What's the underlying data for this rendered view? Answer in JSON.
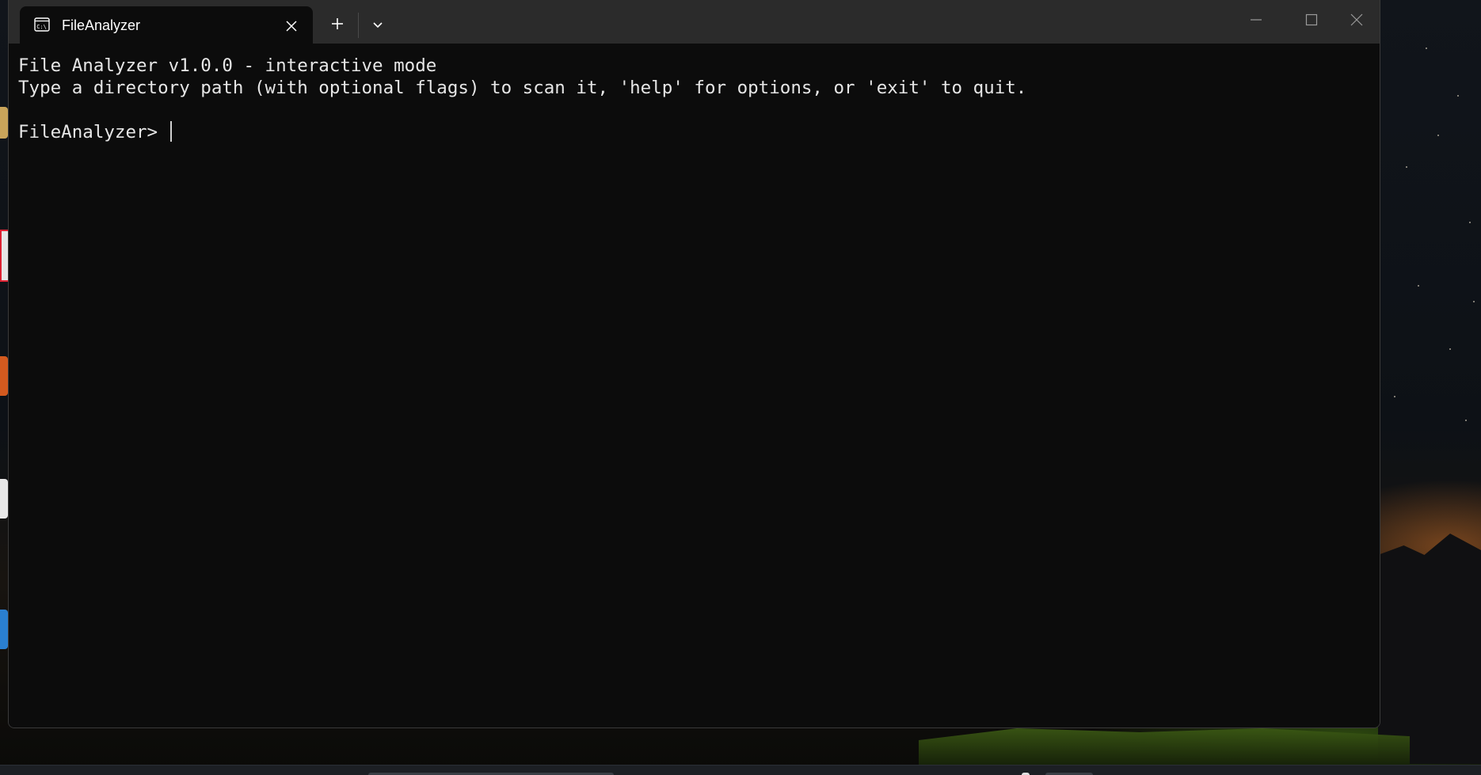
{
  "window": {
    "tab_title": "FileAnalyzer",
    "tab_icon": "terminal-icon",
    "new_tab_icon": "plus-icon",
    "dropdown_icon": "chevron-down-icon",
    "minimize_icon": "minimize-icon",
    "maximize_icon": "maximize-icon",
    "close_icon": "close-icon"
  },
  "terminal": {
    "lines": [
      "File Analyzer v1.0.0 - interactive mode",
      "Type a directory path (with optional flags) to scan it, 'help' for options, or 'exit' to quit."
    ],
    "prompt": "FileAnalyzer> ",
    "input_value": ""
  },
  "colors": {
    "terminal_bg": "#0c0c0c",
    "titlebar_bg": "#2b2b2b",
    "text": "#e6e6e6"
  }
}
